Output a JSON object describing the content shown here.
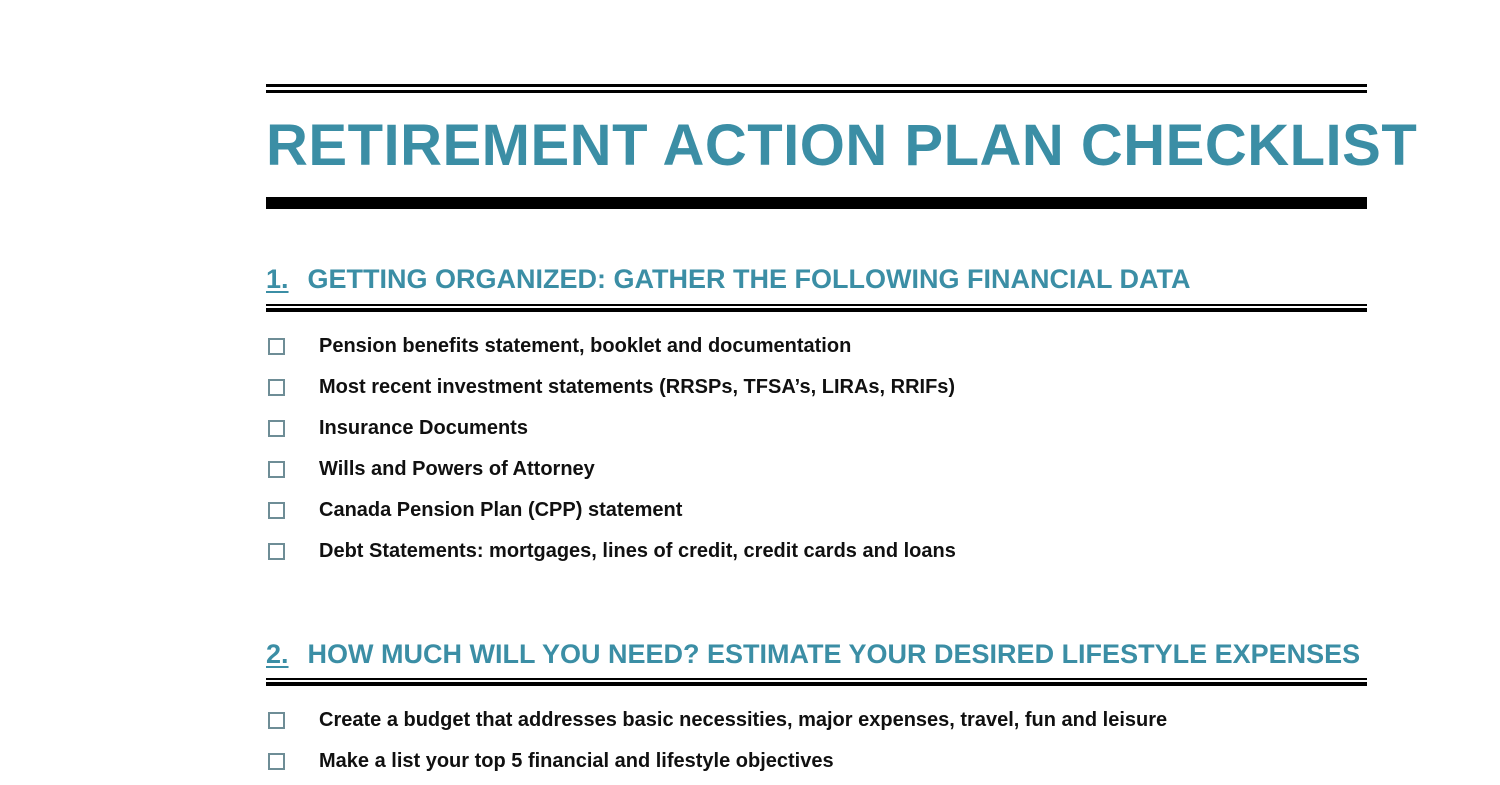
{
  "document": {
    "title": "RETIREMENT ACTION PLAN CHECKLIST",
    "accent_color": "#3b8ea5",
    "rule_color": "#000000",
    "checkbox_border_color": "#6e8d96",
    "text_color": "#101010"
  },
  "sections": [
    {
      "number": "1.",
      "title": "GETTING ORGANIZED: GATHER THE FOLLOWING FINANCIAL DATA",
      "items": [
        {
          "label": "Pension benefits statement, booklet and documentation",
          "checked": false
        },
        {
          "label": "Most recent investment statements (RRSPs, TFSA’s, LIRAs, RRIFs)",
          "checked": false
        },
        {
          "label": "Insurance Documents",
          "checked": false
        },
        {
          "label": "Wills and Powers of Attorney",
          "checked": false
        },
        {
          "label": "Canada Pension Plan (CPP) statement",
          "checked": false
        },
        {
          "label": "Debt Statements: mortgages, lines of credit, credit cards and loans",
          "checked": false
        }
      ]
    },
    {
      "number": "2.",
      "title": "HOW MUCH WILL YOU NEED? ESTIMATE YOUR DESIRED LIFESTYLE EXPENSES",
      "items": [
        {
          "label": "Create a budget that addresses basic necessities, major expenses, travel, fun and leisure",
          "checked": false
        },
        {
          "label": "Make a list your top 5 financial and lifestyle objectives",
          "checked": false
        }
      ]
    }
  ]
}
